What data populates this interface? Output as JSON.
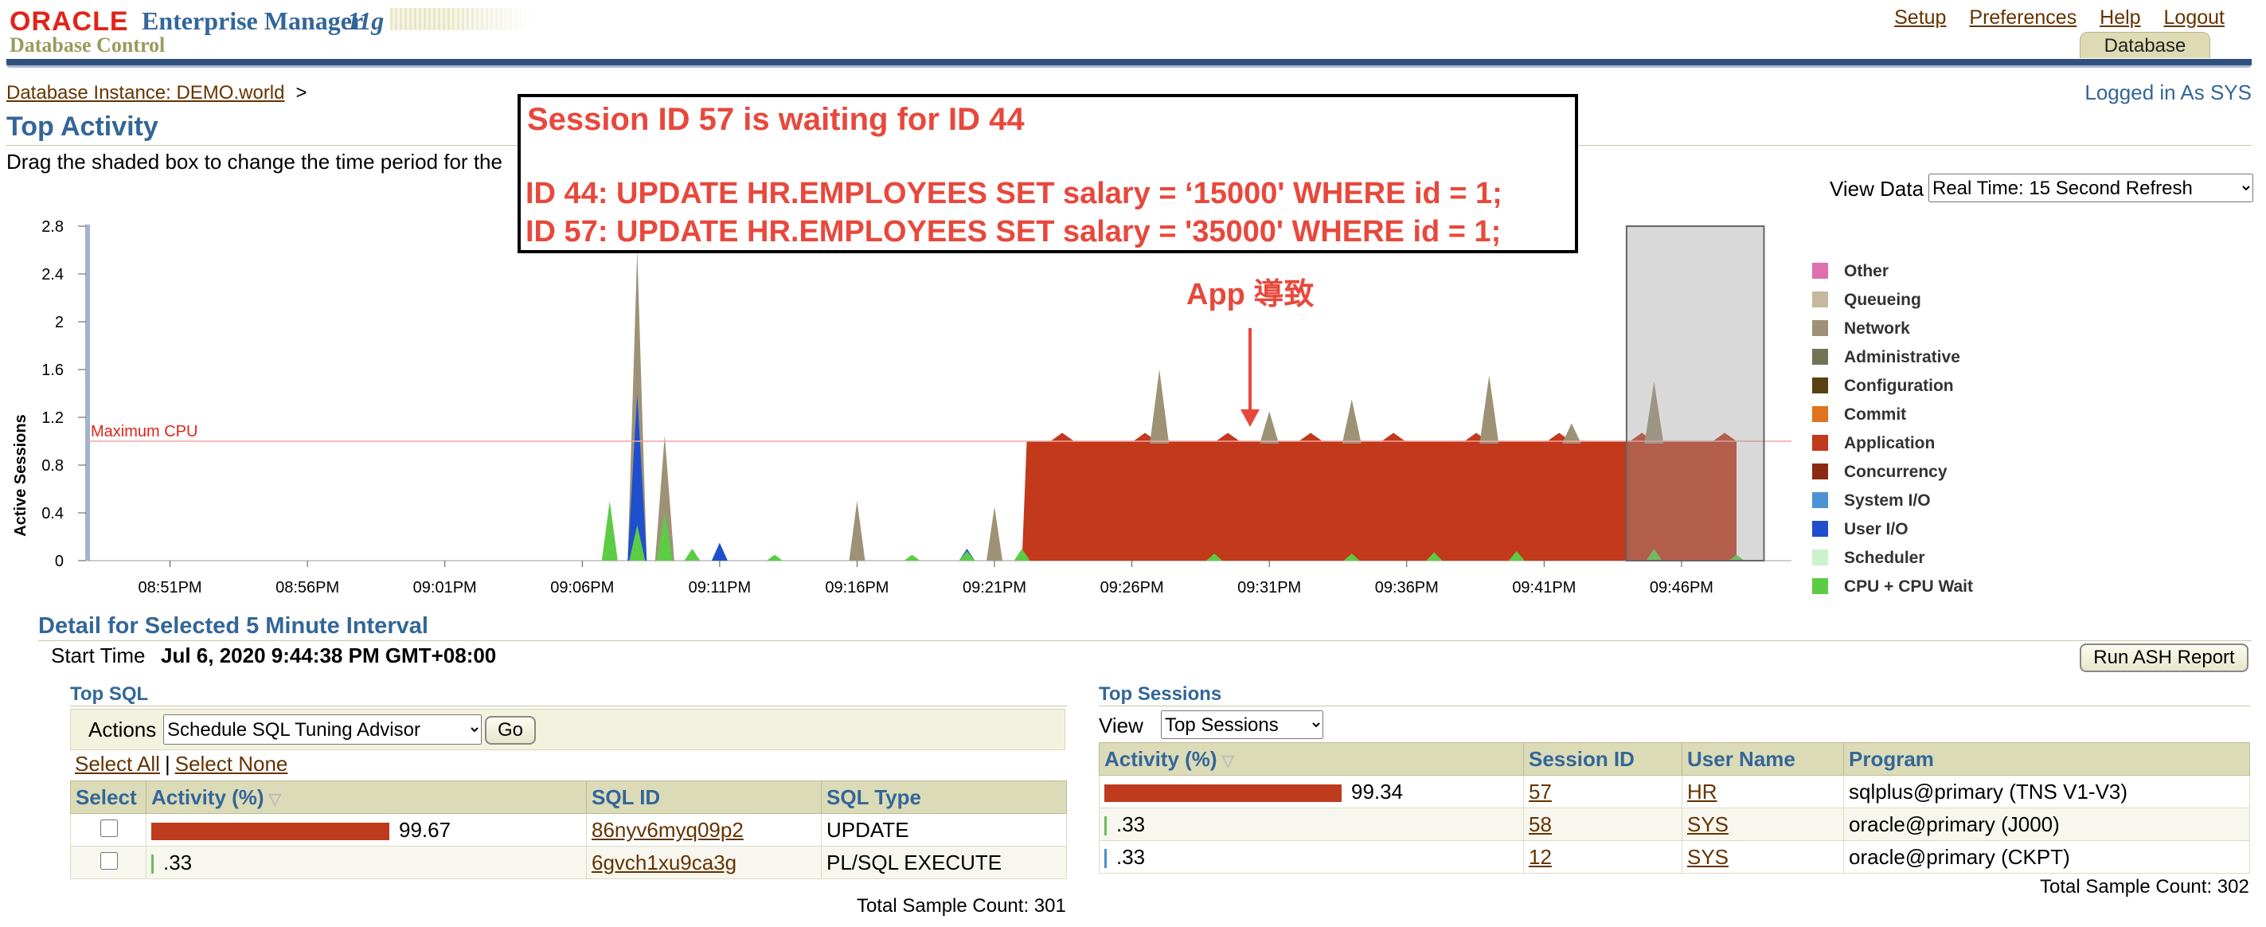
{
  "header": {
    "brand": "ORACLE",
    "product": "Enterprise Manager",
    "version": "11g",
    "subtitle": "Database Control",
    "links": [
      "Setup",
      "Preferences",
      "Help",
      "Logout"
    ],
    "tab": "Database"
  },
  "breadcrumb": {
    "instance": "Database Instance: DEMO.world",
    "separator": ">"
  },
  "logged_in": "Logged in As SYS",
  "page": {
    "title": "Top Activity",
    "instruction": "Drag the shaded box to change the time period for the",
    "view_data_label": "View Data",
    "view_data_value": "Real Time: 15 Second Refresh"
  },
  "annotation": {
    "line1": "Session ID 57 is waiting for ID 44",
    "line2": "ID 44: UPDATE HR.EMPLOYEES SET salary = ‘15000' WHERE id = 1;",
    "line3": "ID 57: UPDATE HR.EMPLOYEES SET salary = '35000' WHERE id = 1;",
    "cause_label": "App 導致",
    "accent": "#e8483c"
  },
  "chart_data": {
    "type": "area",
    "ylabel": "Active Sessions",
    "yticks": [
      "0",
      "0.4",
      "0.8",
      "1.2",
      "1.6",
      "2",
      "2.4",
      "2.8"
    ],
    "ylim": [
      0,
      2.8
    ],
    "xticks": [
      "08:51PM",
      "08:56PM",
      "09:01PM",
      "09:06PM",
      "09:11PM",
      "09:16PM",
      "09:21PM",
      "09:26PM",
      "09:31PM",
      "09:36PM",
      "09:41PM",
      "09:46PM"
    ],
    "max_cpu_label": "Maximum CPU",
    "max_cpu": 1.0,
    "selected_window": [
      "09:44PM",
      "09:49PM"
    ],
    "legend": [
      {
        "name": "Other",
        "color": "#e06fb0"
      },
      {
        "name": "Queueing",
        "color": "#c5b89c"
      },
      {
        "name": "Network",
        "color": "#9e9276"
      },
      {
        "name": "Administrative",
        "color": "#737358"
      },
      {
        "name": "Configuration",
        "color": "#5a3f12"
      },
      {
        "name": "Commit",
        "color": "#e0731f"
      },
      {
        "name": "Application",
        "color": "#c2391b"
      },
      {
        "name": "Concurrency",
        "color": "#8b2a14"
      },
      {
        "name": "System I/O",
        "color": "#4c93d6"
      },
      {
        "name": "User I/O",
        "color": "#1f4fcf"
      },
      {
        "name": "Scheduler",
        "color": "#ccf2cc"
      },
      {
        "name": "CPU + CPU Wait",
        "color": "#5ccc45"
      }
    ],
    "series": [
      {
        "name": "CPU + CPU Wait",
        "x": [
          "09:07PM",
          "09:08PM",
          "09:09PM",
          "09:10PM",
          "09:13PM",
          "09:18PM",
          "09:20PM",
          "09:22PM",
          "09:29PM",
          "09:34PM",
          "09:37PM",
          "09:40PM",
          "09:45PM",
          "09:48PM"
        ],
        "values": [
          0.5,
          0.3,
          0.4,
          0.1,
          0.05,
          0.05,
          0.08,
          0.1,
          0.06,
          0.06,
          0.07,
          0.08,
          0.1,
          0.05
        ]
      },
      {
        "name": "User I/O",
        "x": [
          "09:08PM",
          "09:11PM",
          "09:20PM"
        ],
        "values": [
          1.4,
          0.15,
          0.1
        ]
      },
      {
        "name": "Network",
        "x": [
          "09:08PM",
          "09:09PM",
          "09:16PM",
          "09:21PM",
          "09:27PM",
          "09:31PM",
          "09:34PM",
          "09:39PM",
          "09:42PM",
          "09:45PM"
        ],
        "values": [
          2.6,
          1.05,
          0.5,
          0.45,
          1.6,
          1.25,
          1.35,
          1.55,
          1.15,
          1.5
        ]
      },
      {
        "name": "Application",
        "x": [
          "09:22PM",
          "09:24PM",
          "09:30PM",
          "09:36PM",
          "09:42PM",
          "09:48PM"
        ],
        "values": [
          1.0,
          1.0,
          1.0,
          1.0,
          1.0,
          1.0
        ]
      }
    ]
  },
  "detail": {
    "title": "Detail for Selected 5 Minute Interval",
    "start_time_label": "Start Time",
    "start_time_value": "Jul 6, 2020 9:44:38 PM GMT+08:00",
    "run_ash_button": "Run ASH Report"
  },
  "top_sql": {
    "title": "Top SQL",
    "actions_label": "Actions",
    "actions_value": "Schedule SQL Tuning Advisor",
    "go_button": "Go",
    "select_all": "Select All",
    "select_none": "Select None",
    "columns": [
      "Select",
      "Activity (%)",
      "SQL ID",
      "SQL Type"
    ],
    "rows": [
      {
        "activity": "99.67",
        "activity_pct": 99.67,
        "sql_id": "86nyv6myq09p2",
        "sql_type": "UPDATE"
      },
      {
        "activity": ".33",
        "activity_pct": 0.33,
        "sql_id": "6gvch1xu9ca3g",
        "sql_type": "PL/SQL EXECUTE"
      }
    ],
    "total": "Total Sample Count: 301"
  },
  "top_sessions": {
    "title": "Top Sessions",
    "view_label": "View",
    "view_value": "Top Sessions",
    "columns": [
      "Activity (%)",
      "Session ID",
      "User Name",
      "Program"
    ],
    "rows": [
      {
        "activity": "99.34",
        "activity_pct": 99.34,
        "session_id": "57",
        "user": "HR",
        "program": "sqlplus@primary (TNS V1-V3)"
      },
      {
        "activity": ".33",
        "activity_pct": 0.33,
        "session_id": "58",
        "user": "SYS",
        "program": "oracle@primary (J000)"
      },
      {
        "activity": ".33",
        "activity_pct": 0.33,
        "session_id": "12",
        "user": "SYS",
        "program": "oracle@primary (CKPT)"
      }
    ],
    "total": "Total Sample Count: 302"
  }
}
